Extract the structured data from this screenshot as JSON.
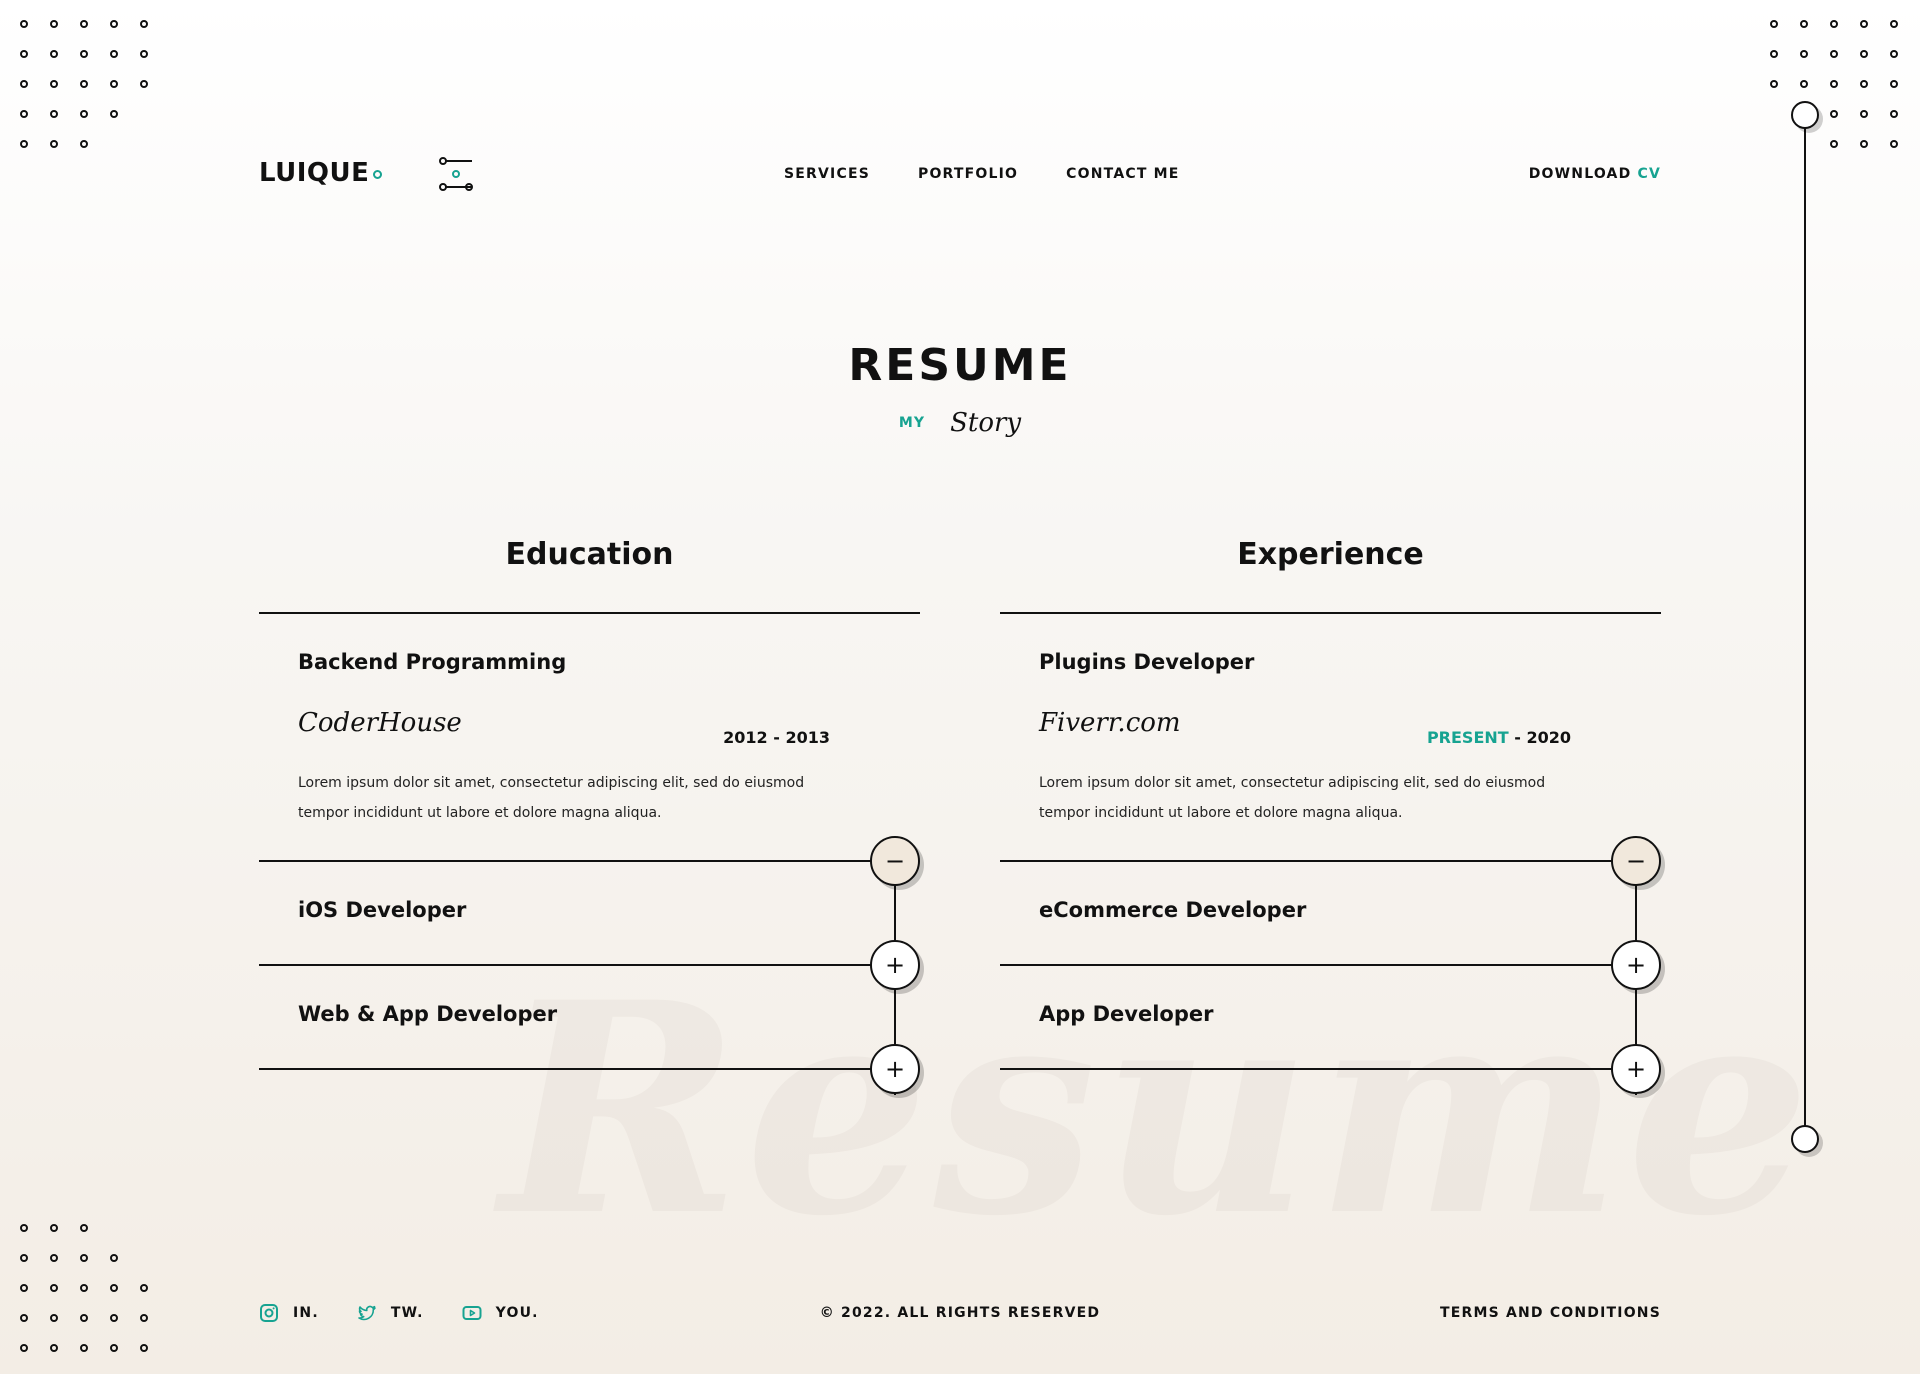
{
  "header": {
    "logo": "LUIQUE",
    "nav": [
      "SERVICES",
      "PORTFOLIO",
      "CONTACT ME"
    ],
    "download_label": "DOWNLOAD",
    "download_accent": "CV"
  },
  "hero": {
    "title": "RESUME",
    "subtitle_small": "MY",
    "subtitle_script": "Story",
    "watermark": "Resume"
  },
  "education": {
    "heading": "Education",
    "open_item": {
      "title": "Backend Programming",
      "company": "CoderHouse",
      "years": "2012 - 2013",
      "description": "Lorem ipsum dolor sit amet, consectetur adipiscing elit, sed do eiusmod tempor incididunt ut labore et dolore magna aliqua."
    },
    "collapsed": [
      "iOS Developer",
      "Web & App Developer"
    ]
  },
  "experience": {
    "heading": "Experience",
    "open_item": {
      "title": "Plugins Developer",
      "company": "Fiverr.com",
      "years_accent": "PRESENT",
      "years_rest": " - 2020",
      "description": "Lorem ipsum dolor sit amet, consectetur adipiscing elit, sed do eiusmod tempor incididunt ut labore et dolore magna aliqua."
    },
    "collapsed": [
      "eCommerce Developer",
      "App Developer"
    ]
  },
  "buttons": {
    "minus": "−",
    "plus": "+"
  },
  "footer": {
    "social": [
      {
        "label": "IN.",
        "icon": "instagram-icon"
      },
      {
        "label": "TW.",
        "icon": "twitter-icon"
      },
      {
        "label": "YOU.",
        "icon": "youtube-icon"
      }
    ],
    "copyright": "© 2022. ALL RIGHTS RESERVED",
    "terms": "TERMS AND CONDITIONS"
  },
  "colors": {
    "accent": "#17a391",
    "ink": "#111111",
    "background": "#f3ede5"
  }
}
